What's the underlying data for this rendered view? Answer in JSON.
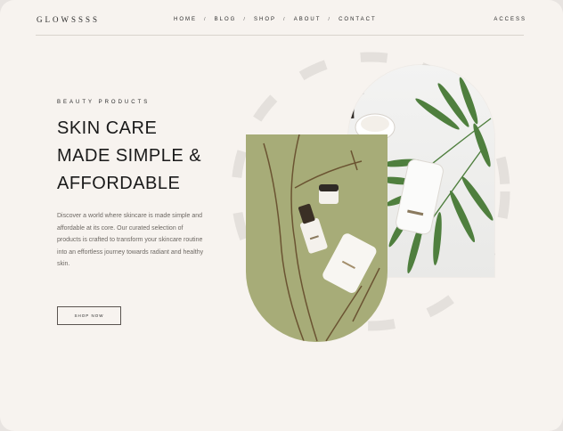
{
  "header": {
    "logo": "GLOWSSSS",
    "nav": [
      {
        "label": "HOME"
      },
      {
        "label": "BLOG"
      },
      {
        "label": "SHOP"
      },
      {
        "label": "ABOUT"
      },
      {
        "label": "CONTACT"
      }
    ],
    "nav_separator": "/",
    "account_label": "ACCESS"
  },
  "hero": {
    "eyebrow": "BEAUTY PRODUCTS",
    "title_lines": [
      "SKIN CARE",
      "MADE SIMPLE &",
      "AFFORDABLE"
    ],
    "description": "Discover a world where skincare is made simple and affordable at its core. Our curated selection of products is crafted to transform your skincare routine into an effortless journey towards radiant and healthy skin.",
    "cta_label": "SHOP NOW"
  },
  "colors": {
    "background": "#f7f3ef",
    "text_dark": "#1a1a1a",
    "olive": "#a7ac78",
    "ring": "#e4e0dc",
    "leaf": "#4f7f3e"
  },
  "images": {
    "back_panel": "skincare-jars-with-palm-leaves",
    "front_panel": "serum-bottle-cream-jar-on-olive-background"
  }
}
